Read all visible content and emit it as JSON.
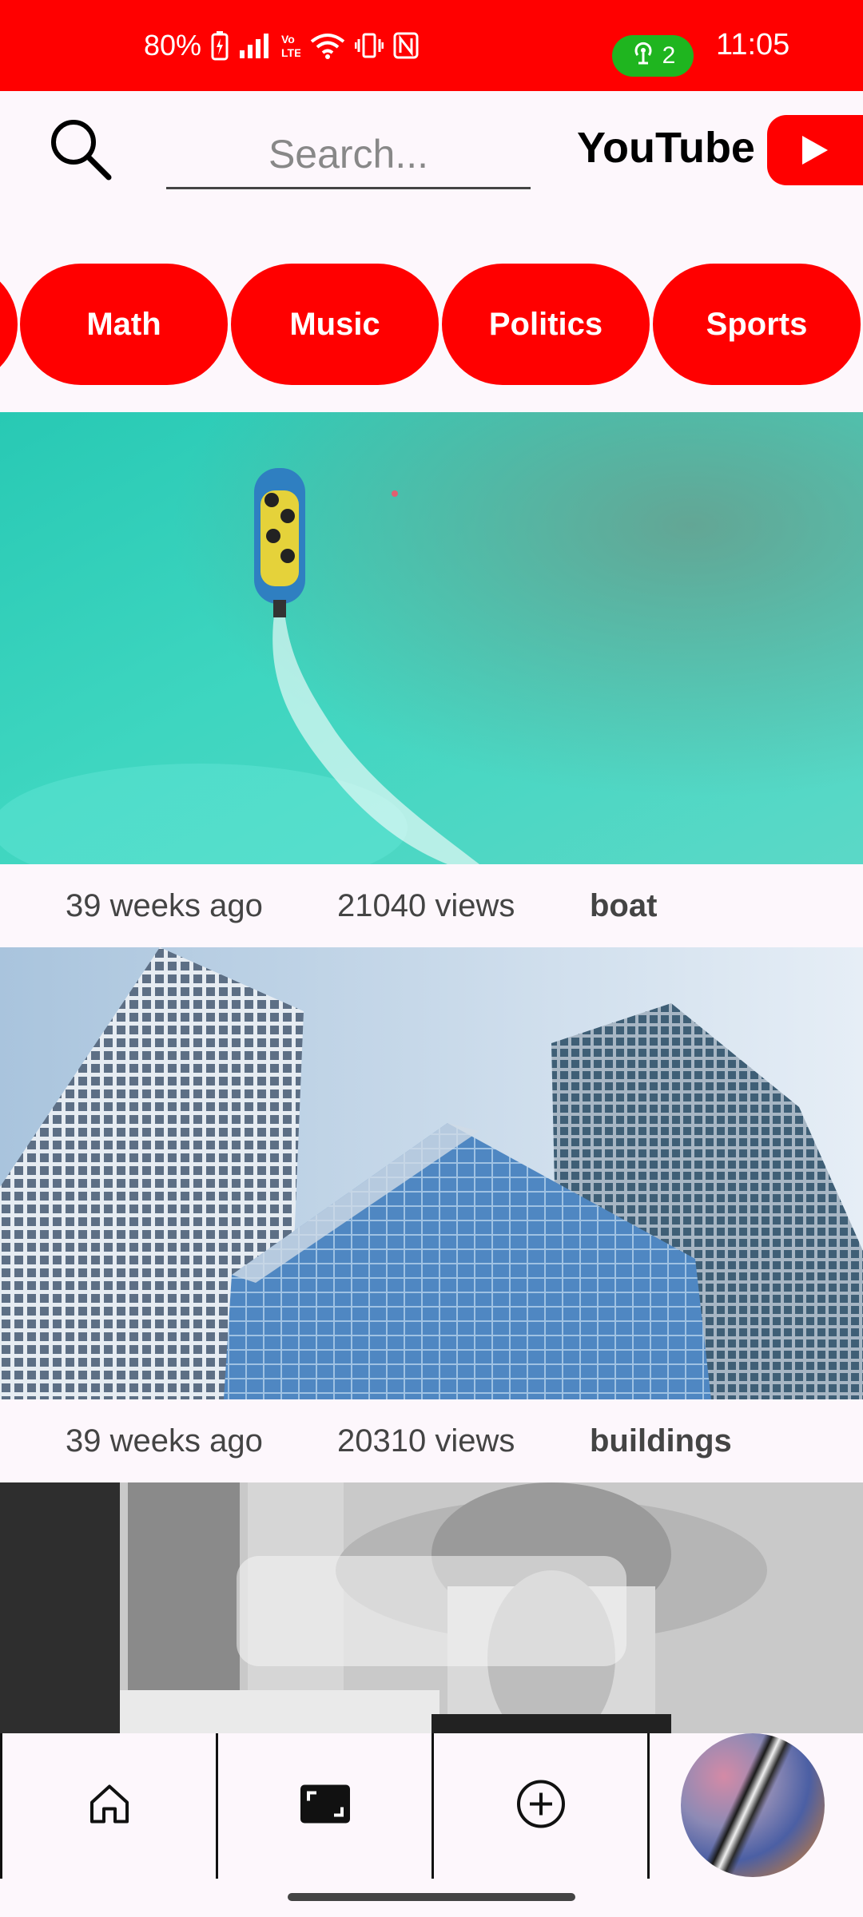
{
  "status_bar": {
    "battery": "80%",
    "hotspot_count": "2",
    "time": "11:05",
    "background": "#ff0000"
  },
  "header": {
    "search_placeholder": "Search...",
    "brand": "YouTube"
  },
  "categories": [
    "Math",
    "Music",
    "Politics",
    "Sports"
  ],
  "videos": [
    {
      "age": "39 weeks ago",
      "views": "21040 views",
      "title": "boat"
    },
    {
      "age": "39 weeks ago",
      "views": "20310 views",
      "title": "buildings"
    }
  ],
  "bottom_nav": {
    "items": [
      "home-icon",
      "fullscreen-icon",
      "add-icon",
      "profile-avatar"
    ]
  },
  "colors": {
    "accent": "#ff0000",
    "background": "#fdf7fc"
  }
}
